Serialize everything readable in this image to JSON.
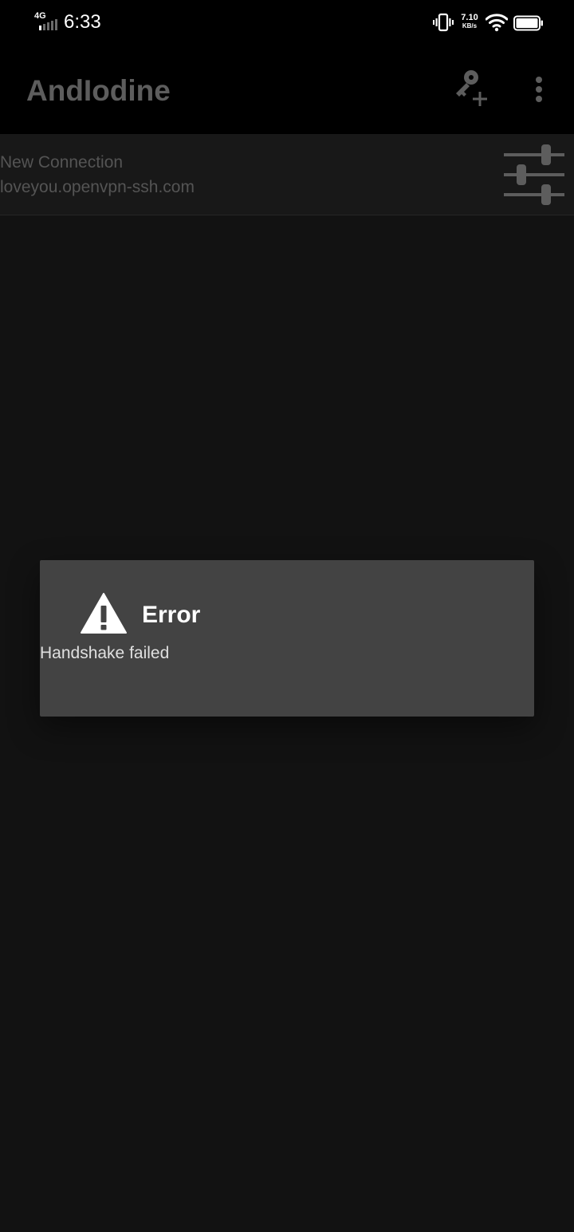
{
  "status_bar": {
    "network": "4G",
    "time": "6:33",
    "speed_value": "7.10",
    "speed_unit": "KB/s",
    "icons": [
      "signal-icon",
      "vibrate-icon",
      "wifi-icon",
      "battery-icon"
    ]
  },
  "app_bar": {
    "title": "AndIodine",
    "actions": [
      "add-key-icon",
      "overflow-menu-icon"
    ]
  },
  "connection": {
    "name": "New Connection",
    "host": "loveyou.openvpn-ssh.com",
    "action_icon": "tune-icon"
  },
  "dialog": {
    "icon": "warning-icon",
    "title": "Error",
    "message": "Handshake failed"
  },
  "colors": {
    "background": "#121212",
    "app_bar": "#000000",
    "dialog": "#434343",
    "muted_text": "#545454"
  }
}
